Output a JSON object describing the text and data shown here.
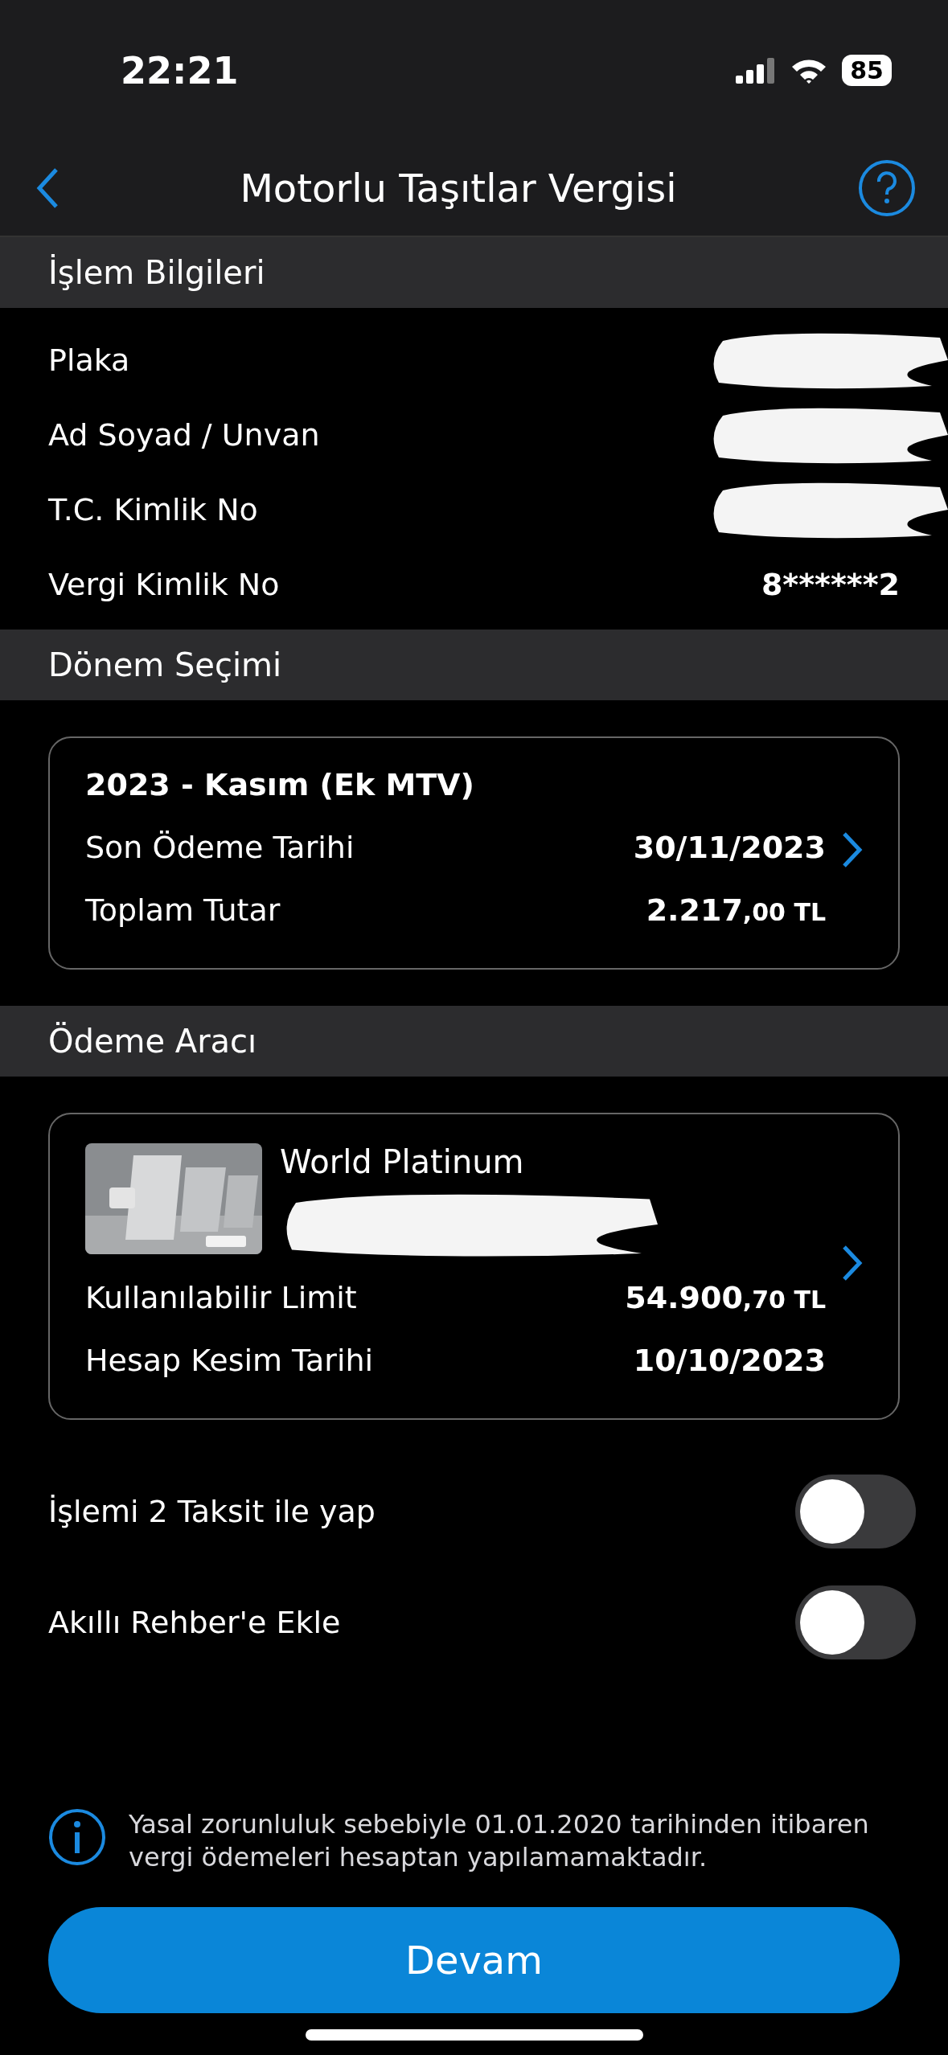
{
  "status_bar": {
    "time": "22:21",
    "battery": "85"
  },
  "nav": {
    "title": "Motorlu Taşıtlar Vergisi"
  },
  "sections": [
    {
      "kind": "info",
      "title": "İşlem Bilgileri",
      "rows": [
        {
          "label": "Plaka",
          "redacted": true
        },
        {
          "label": "Ad Soyad / Unvan",
          "redacted": true
        },
        {
          "label": "T.C. Kimlik No",
          "redacted": true
        },
        {
          "label": "Vergi Kimlik No",
          "value": "8******2",
          "redacted": false
        }
      ]
    },
    {
      "kind": "period",
      "title": "Dönem Seçimi",
      "card": {
        "heading": "2023 - Kasım (Ek MTV)",
        "rows": [
          {
            "label": "Son Ödeme Tarihi",
            "value": "30/11/2023"
          },
          {
            "label": "Toplam Tutar",
            "value": "2.217",
            "fraction": ",00",
            "currency": "TL"
          }
        ]
      }
    },
    {
      "kind": "payment",
      "title": "Ödeme Aracı",
      "card": {
        "name": "World Platinum",
        "number_redacted": true,
        "rows": [
          {
            "label": "Kullanılabilir Limit",
            "value": "54.900",
            "fraction": ",70",
            "currency": "TL"
          },
          {
            "label": "Hesap Kesim Tarihi",
            "value": "10/10/2023"
          }
        ]
      }
    }
  ],
  "toggles": [
    {
      "label": "İşlemi 2 Taksit ile yap",
      "on": false
    },
    {
      "label": "Akıllı Rehber'e Ekle",
      "on": false
    }
  ],
  "notice": "Yasal zorunluluk sebebiyle 01.01.2020 tarihinden itibaren vergi ödemeleri hesaptan yapılamamaktadır.",
  "primary_button": "Devam"
}
